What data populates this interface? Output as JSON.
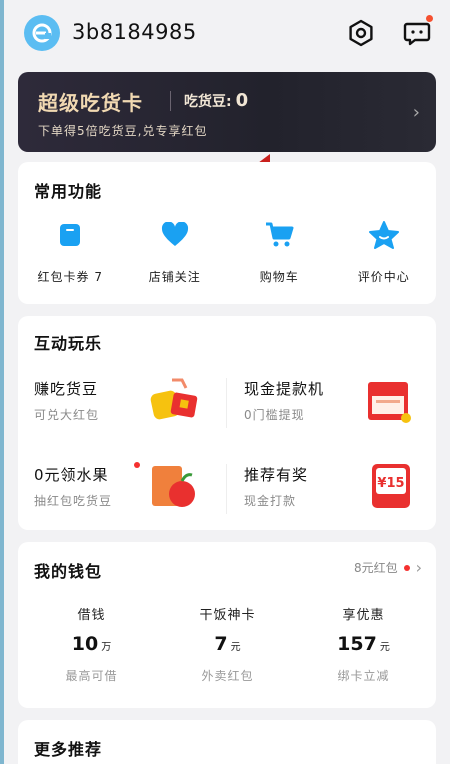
{
  "header": {
    "username": "3b8184985"
  },
  "super_card": {
    "title": "超级吃货卡",
    "beans_label": "吃货豆:",
    "beans_value": "0",
    "subtitle": "下单得5倍吃货豆,兑专享红包"
  },
  "common_functions": {
    "title": "常用功能",
    "items": [
      {
        "label": "红包卡券 7",
        "icon": "coupon-icon"
      },
      {
        "label": "店铺关注",
        "icon": "heart-icon"
      },
      {
        "label": "购物车",
        "icon": "cart-icon"
      },
      {
        "label": "评价中心",
        "icon": "star-icon"
      }
    ]
  },
  "interactive": {
    "title": "互动玩乐",
    "items": [
      {
        "title": "赚吃货豆",
        "subtitle": "可兑大红包"
      },
      {
        "title": "现金提款机",
        "subtitle": "0门槛提现"
      },
      {
        "title": "0元领水果",
        "subtitle": "抽红包吃货豆"
      },
      {
        "title": "推荐有奖",
        "subtitle": "现金打款",
        "badge": "¥15"
      }
    ]
  },
  "wallet": {
    "title": "我的钱包",
    "right_text": "8元红包",
    "columns": [
      {
        "label": "借钱",
        "value": "10",
        "unit": "万",
        "sub": "最高可借"
      },
      {
        "label": "干饭神卡",
        "value": "7",
        "unit": "元",
        "sub": "外卖红包"
      },
      {
        "label": "享优惠",
        "value": "157",
        "unit": "元",
        "sub": "绑卡立减"
      }
    ]
  },
  "more": {
    "title": "更多推荐"
  },
  "colors": {
    "accent_blue": "#1aa1f2",
    "red": "#f5302f",
    "gold": "#f1d9b2"
  }
}
